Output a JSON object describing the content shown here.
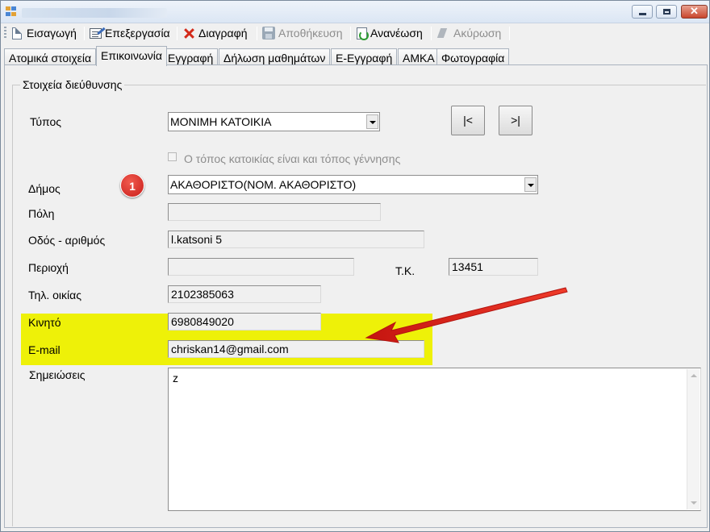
{
  "toolbar": {
    "insert": "Εισαγωγή",
    "edit": "Επεξεργασία",
    "delete": "Διαγραφή",
    "save": "Αποθήκευση",
    "refresh": "Ανανέωση",
    "cancel": "Ακύρωση"
  },
  "tabs": [
    "Ατομικά στοιχεία",
    "Επικοινωνία",
    "Εγγραφή",
    "Δήλωση μαθημάτων",
    "Ε-Εγγραφή",
    "ΑΜΚΑ",
    "Φωτογραφία"
  ],
  "group": {
    "legend": "Στοιχεία διεύθυνσης"
  },
  "form": {
    "type_label": "Τύπος",
    "type_value": "ΜΟΝΙΜΗ ΚΑΤΟΙΚΙΑ",
    "first_button": "|<",
    "last_button": ">|",
    "birthplace_checkbox_label": "Ο τόπος κατοικίας είναι και τόπος γέννησης",
    "birthplace_checked": false,
    "municipality_label": "Δήμος",
    "municipality_value": "ΑΚΑΘΟΡΙΣΤΟ(ΝΟΜ. ΑΚΑΘΟΡΙΣΤΟ)",
    "city_label": "Πόλη",
    "city_value": "",
    "street_label": "Οδός - αριθμός",
    "street_value": "l.katsoni 5",
    "area_label": "Περιοχή",
    "area_value": "",
    "postcode_label": "Τ.Κ.",
    "postcode_value": "13451",
    "home_phone_label": "Τηλ. οικίας",
    "home_phone_value": "2102385063",
    "mobile_label": "Κινητό",
    "mobile_value": "6980849020",
    "email_label": "E-mail",
    "email_value": "chriskan14@gmail.com",
    "notes_label": "Σημειώσεις",
    "notes_value": "z"
  },
  "annotation": {
    "badge_number": "1",
    "badge_color": "#d3231e",
    "highlight_color": "#eef108",
    "arrow_color": "#e2231a"
  }
}
